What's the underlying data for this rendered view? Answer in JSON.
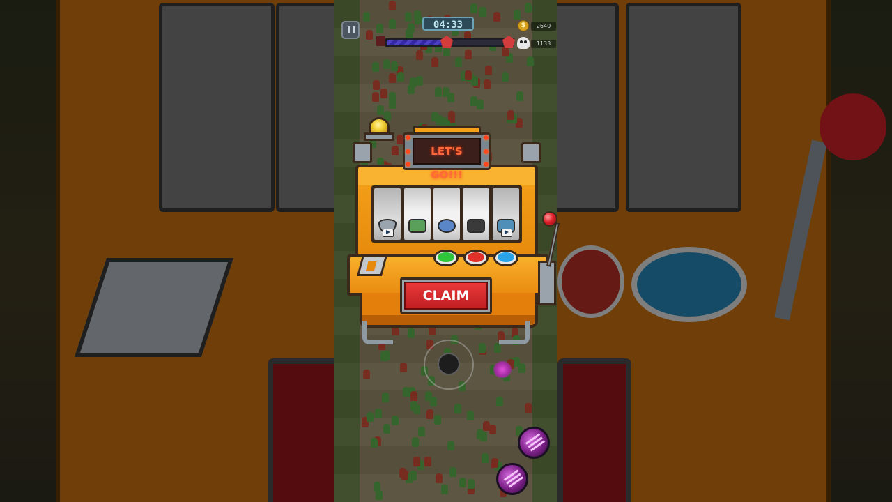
{
  "hud": {
    "timer": "04:33",
    "coin_icon_label": "$",
    "coins": "2640",
    "kills": "1133",
    "wave_progress": 0.48
  },
  "slot_machine": {
    "sign_text": "LET'S GO!!!",
    "reels": [
      {
        "item": "steel-bowl-armor-icon",
        "has_video_badge": true
      },
      {
        "item": "green-canister-icon",
        "has_video_badge": false
      },
      {
        "item": "blue-orb-shield-icon",
        "has_video_badge": false
      },
      {
        "item": "black-helmet-icon",
        "has_video_badge": false
      },
      {
        "item": "blue-cup-icon",
        "has_video_badge": true
      }
    ],
    "buttons": [
      "green",
      "red",
      "blue"
    ],
    "claim_label": "CLAIM"
  },
  "colors": {
    "machine_orange": "#f5a21a",
    "claim_red": "#d62b2d",
    "sign_text": "#ff6a3a",
    "button_green": "#2fc43a",
    "button_red": "#e0302a",
    "button_blue": "#2aa3e6"
  }
}
